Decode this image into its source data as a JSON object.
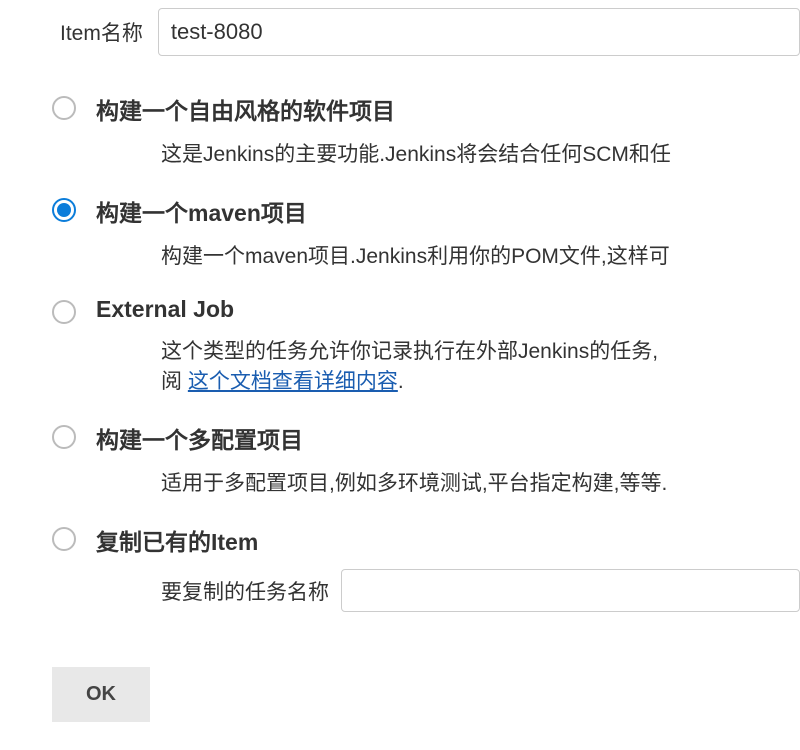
{
  "itemName": {
    "label": "Item名称",
    "value": "test-8080"
  },
  "options": {
    "freestyle": {
      "title": "构建一个自由风格的软件项目",
      "desc": "这是Jenkins的主要功能.Jenkins将会结合任何SCM和任",
      "selected": false
    },
    "maven": {
      "title": "构建一个maven项目",
      "desc": "构建一个maven项目.Jenkins利用你的POM文件,这样可",
      "selected": true
    },
    "external": {
      "title": "External Job",
      "desc_prefix": "这个类型的任务允许你记录执行在外部Jenkins的任务,",
      "desc_line2_prefix": "阅 ",
      "desc_link": "这个文档查看详细内容",
      "desc_suffix": ".",
      "selected": false
    },
    "multiconfig": {
      "title": "构建一个多配置项目",
      "desc": "适用于多配置项目,例如多环境测试,平台指定构建,等等.",
      "selected": false
    },
    "copy": {
      "title": "复制已有的Item",
      "copy_label": "要复制的任务名称",
      "copy_value": "",
      "selected": false
    }
  },
  "ok_button": "OK"
}
